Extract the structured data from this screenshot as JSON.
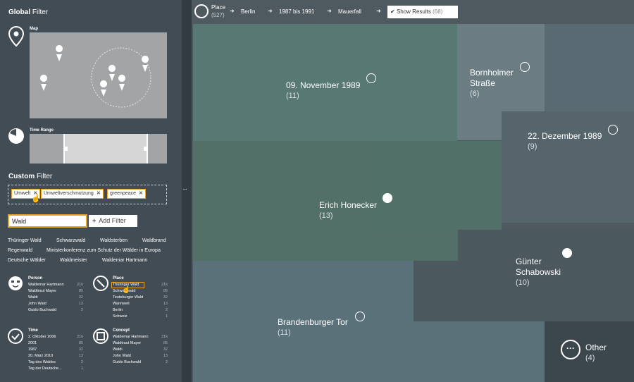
{
  "global_filter": {
    "bold": "Global",
    "rest": "Filter"
  },
  "map": {
    "label": "Map"
  },
  "time_range": {
    "label": "Time Range"
  },
  "custom_filter": {
    "bold": "Custom",
    "rest": "Filter"
  },
  "tags": [
    {
      "label": "Umwelt"
    },
    {
      "label": "Umweltverschmutzung"
    },
    {
      "label": "greenpeace"
    }
  ],
  "search": {
    "value": "Wald",
    "add_label": "Add Filter"
  },
  "suggestions": [
    "Thüringer Wald",
    "Schwarzwald",
    "Waldsterben",
    "Waldbrand",
    "Regenwald",
    "Ministerkonferenz zum Schutz der Wälder in Europa",
    "Deutsche Wälder",
    "Waldmeister",
    "Waldemar Hartmann"
  ],
  "facets": {
    "person": {
      "title": "Person",
      "rows": [
        [
          "Waldemar Hartmann",
          "21k"
        ],
        [
          "Waldtraut Mayer",
          "85"
        ],
        [
          "Waldi",
          "32"
        ],
        [
          "John Wald",
          "13"
        ],
        [
          "Guido Buchwald",
          "2"
        ]
      ]
    },
    "place": {
      "title": "Place",
      "rows": [
        [
          "Thüringer Wald",
          "21k"
        ],
        [
          "Schwarzwald",
          "85"
        ],
        [
          "Teuteburger Wald",
          "32"
        ],
        [
          "Wannwell",
          "13"
        ],
        [
          "Berlin",
          "2"
        ],
        [
          "Schweiz",
          "1"
        ]
      ]
    },
    "time": {
      "title": "Time",
      "rows": [
        [
          "2. Oktober 2006",
          "21k"
        ],
        [
          "2001",
          "85"
        ],
        [
          "1987",
          "32"
        ],
        [
          "20. März 2010",
          "13"
        ],
        [
          "Tag des Waldes",
          "2"
        ],
        [
          "Tag der Deutsche...",
          "1"
        ]
      ]
    },
    "concept": {
      "title": "Concept",
      "rows": [
        [
          "Waldemar Hartmann",
          "21k"
        ],
        [
          "Waldtraut Mayer",
          "85"
        ],
        [
          "Waldi",
          "32"
        ],
        [
          "John Wald",
          "13"
        ],
        [
          "Guido Buchwald",
          "2"
        ]
      ]
    }
  },
  "breadcrumb": {
    "place": "Place",
    "place_count": "(527)",
    "berlin": "Berlin",
    "time_from": "1987",
    "time_bis": "bis",
    "time_to": "1991",
    "mauerfall": "Mauerfall",
    "show": "Show Results",
    "show_count": "(68)"
  },
  "tiles": [
    {
      "title": "09. November 1989",
      "count": "(11)"
    },
    {
      "title": "Bornholmer Straße",
      "count": "(6)"
    },
    {
      "title": "22. Dezember 1989",
      "count": "(9)"
    },
    {
      "title": "Erich Honecker",
      "count": "(13)"
    },
    {
      "title": "Günter Schabowski",
      "count": "(10)"
    },
    {
      "title": "Brandenburger Tor",
      "count": "(11)"
    },
    {
      "title": "Other",
      "count": "(4)"
    }
  ],
  "colors": {
    "orange": "#e8a326",
    "panel": "#424c55"
  }
}
